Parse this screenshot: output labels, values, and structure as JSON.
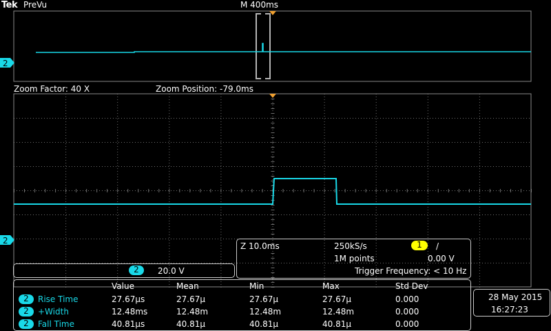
{
  "header": {
    "brand": "Tek",
    "status": "PreVu",
    "horizontal_scale": "M 400ms"
  },
  "zoom": {
    "factor": "Zoom Factor: 40 X",
    "position": "Zoom Position: -79.0ms"
  },
  "channel": {
    "number": "2",
    "scale": "20.0 V",
    "color": "#19d9e8"
  },
  "acquisition": {
    "zoom_scale": "Z 10.0ms",
    "sample_rate": "250kS/s",
    "record_length": "1M points",
    "trigger_source": "1",
    "trigger_slope": "/",
    "trigger_level": "0.00 V",
    "trigger_frequency": "Trigger Frequency: < 10 Hz",
    "trigger_color": "#ffff00"
  },
  "measurements": {
    "headers": [
      "Value",
      "Mean",
      "Min",
      "Max",
      "Std Dev"
    ],
    "rows": [
      {
        "channel": "2",
        "name": "Rise Time",
        "value": "27.67μs",
        "mean": "27.67μ",
        "min": "27.67μ",
        "max": "27.67μ",
        "std": "0.000"
      },
      {
        "channel": "2",
        "name": "+Width",
        "value": "12.48ms",
        "mean": "12.48m",
        "min": "12.48m",
        "max": "12.48m",
        "std": "0.000"
      },
      {
        "channel": "2",
        "name": "Fall Time",
        "value": "40.81μs",
        "mean": "40.81μ",
        "min": "40.81μ",
        "max": "40.81μ",
        "std": "0.000"
      }
    ]
  },
  "datetime": {
    "date": "28 May  2015",
    "time": "16:27:23"
  },
  "colors": {
    "trace": "#19d9e8",
    "trigger_marker": "#f0a030",
    "grid": "#7a7a7a",
    "frame": "#9a9a9a"
  }
}
